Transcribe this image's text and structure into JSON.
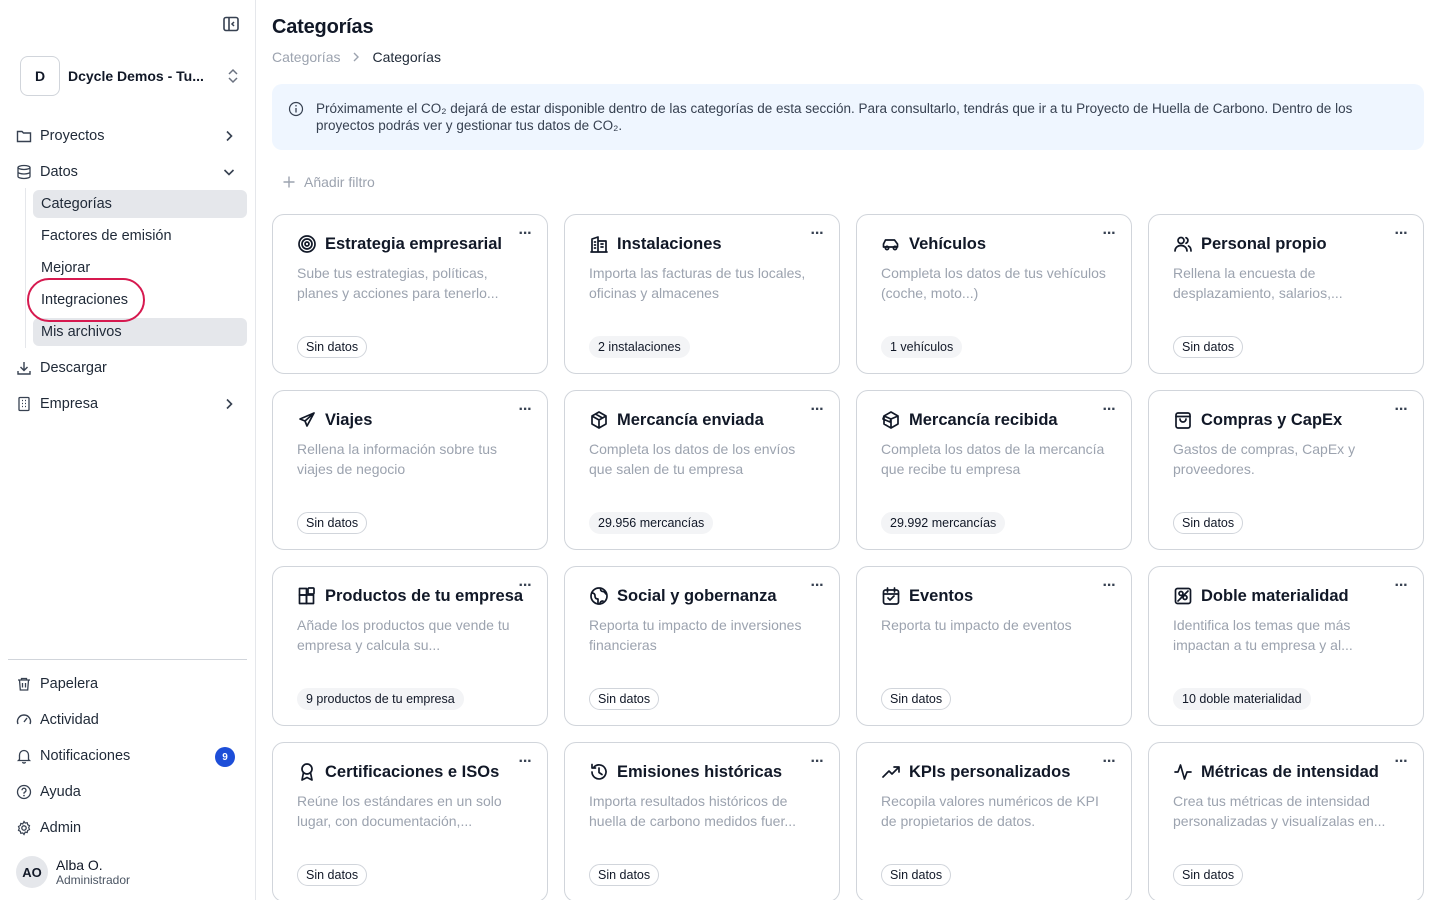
{
  "sidebar": {
    "org_initial": "D",
    "org_name": "Dcycle Demos - Tu...",
    "nav": [
      {
        "label": "Proyectos",
        "icon": "folder-icon"
      },
      {
        "label": "Datos",
        "icon": "database-icon"
      },
      {
        "label": "Descargar",
        "icon": "download-icon"
      },
      {
        "label": "Empresa",
        "icon": "building-icon"
      }
    ],
    "datos_sub": [
      {
        "label": "Categorías",
        "active": true
      },
      {
        "label": "Factores de emisión"
      },
      {
        "label": "Mejorar"
      },
      {
        "label": "Integraciones",
        "highlighted": true
      },
      {
        "label": "Mis archivos"
      }
    ],
    "bottom": [
      {
        "label": "Papelera",
        "icon": "trash-icon"
      },
      {
        "label": "Actividad",
        "icon": "gauge-icon"
      },
      {
        "label": "Notificaciones",
        "icon": "bell-icon",
        "badge": "9"
      },
      {
        "label": "Ayuda",
        "icon": "help-icon"
      },
      {
        "label": "Admin",
        "icon": "gear-icon"
      }
    ],
    "user": {
      "initials": "AO",
      "name": "Alba O.",
      "role": "Administrador"
    }
  },
  "main": {
    "title": "Categorías",
    "breadcrumb": [
      "Categorías",
      "Categorías"
    ],
    "notice": "Próximamente el CO₂ dejará de estar disponible dentro de las categorías de esta sección. Para consultarlo, tendrás que ir a tu Proyecto de Huella de Carbono. Dentro de los proyectos podrás ver y gestionar tus datos de CO₂.",
    "add_filter": "Añadir filtro",
    "more_label": "···",
    "cards": [
      {
        "icon": "target-icon",
        "title": "Estrategia empresarial",
        "desc": "Sube tus estrategias, políticas, planes y acciones para tenerlo...",
        "badge": "Sin datos",
        "has_data": false
      },
      {
        "icon": "buildings-icon",
        "title": "Instalaciones",
        "desc": "Importa las facturas de tus locales, oficinas y almacenes",
        "badge": "2 instalaciones",
        "has_data": true
      },
      {
        "icon": "car-icon",
        "title": "Vehículos",
        "desc": "Completa los datos de tus vehículos (coche, moto...)",
        "badge": "1 vehículos",
        "has_data": true
      },
      {
        "icon": "users-icon",
        "title": "Personal propio",
        "desc": "Rellena la encuesta de desplazamiento, salarios,...",
        "badge": "Sin datos",
        "has_data": false
      },
      {
        "icon": "plane-icon",
        "title": "Viajes",
        "desc": "Rellena la información sobre tus viajes de negocio",
        "badge": "Sin datos",
        "has_data": false
      },
      {
        "icon": "package-icon",
        "title": "Mercancía enviada",
        "desc": "Completa los datos de los envíos que salen de tu empresa",
        "badge": "29.956 mercancías",
        "has_data": true
      },
      {
        "icon": "package-open-icon",
        "title": "Mercancía recibida",
        "desc": "Completa los datos de la mercancía que recibe tu empresa",
        "badge": "29.992 mercancías",
        "has_data": true
      },
      {
        "icon": "shopping-bag-icon",
        "title": "Compras y CapEx",
        "desc": "Gastos de compras, CapEx y proveedores.",
        "badge": "Sin datos",
        "has_data": false
      },
      {
        "icon": "blocks-icon",
        "title": "Productos de tu empresa",
        "desc": "Añade los productos que vende tu empresa y calcula su...",
        "badge": "9 productos de tu empresa",
        "has_data": true
      },
      {
        "icon": "globe-icon",
        "title": "Social y gobernanza",
        "desc": "Reporta tu impacto de inversiones financieras",
        "badge": "Sin datos",
        "has_data": false
      },
      {
        "icon": "calendar-icon",
        "title": "Eventos",
        "desc": "Reporta tu impacto de eventos",
        "badge": "Sin datos",
        "has_data": false
      },
      {
        "icon": "materiality-icon",
        "title": "Doble materialidad",
        "desc": "Identifica los temas que más impactan a tu empresa y al...",
        "badge": "10 doble materialidad",
        "has_data": true
      },
      {
        "icon": "award-icon",
        "title": "Certificaciones e ISOs",
        "desc": "Reúne los estándares en un solo lugar, con documentación,...",
        "badge": "Sin datos",
        "has_data": false
      },
      {
        "icon": "history-icon",
        "title": "Emisiones históricas",
        "desc": "Importa resultados históricos de huella de carbono medidos fuer...",
        "badge": "Sin datos",
        "has_data": false
      },
      {
        "icon": "trending-up-icon",
        "title": "KPIs personalizados",
        "desc": "Recopila valores numéricos de KPI de propietarios de datos.",
        "badge": "Sin datos",
        "has_data": false
      },
      {
        "icon": "activity-icon",
        "title": "Métricas de intensidad",
        "desc": "Crea tus métricas de intensidad personalizadas y visualízalas en...",
        "badge": "Sin datos",
        "has_data": false
      }
    ]
  }
}
